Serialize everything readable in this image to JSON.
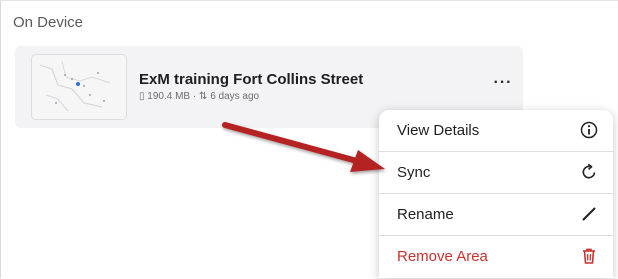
{
  "section": {
    "header": "On Device"
  },
  "map_area": {
    "title": "ExM training Fort Collins Street",
    "size": "190.4 MB",
    "separator": "·",
    "updated": "6 days ago",
    "icons": {
      "size": "storage-icon",
      "updated": "sync-arrows-icon",
      "more": "more-options-icon"
    }
  },
  "context_menu": {
    "items": [
      {
        "label": "View Details",
        "icon": "info-icon"
      },
      {
        "label": "Sync",
        "icon": "sync-icon"
      },
      {
        "label": "Rename",
        "icon": "pencil-icon"
      },
      {
        "label": "Remove Area",
        "icon": "trash-icon"
      }
    ]
  },
  "colors": {
    "danger": "#c9322f",
    "annotation_arrow": "#b52424",
    "card_background": "#f3f3f5"
  }
}
